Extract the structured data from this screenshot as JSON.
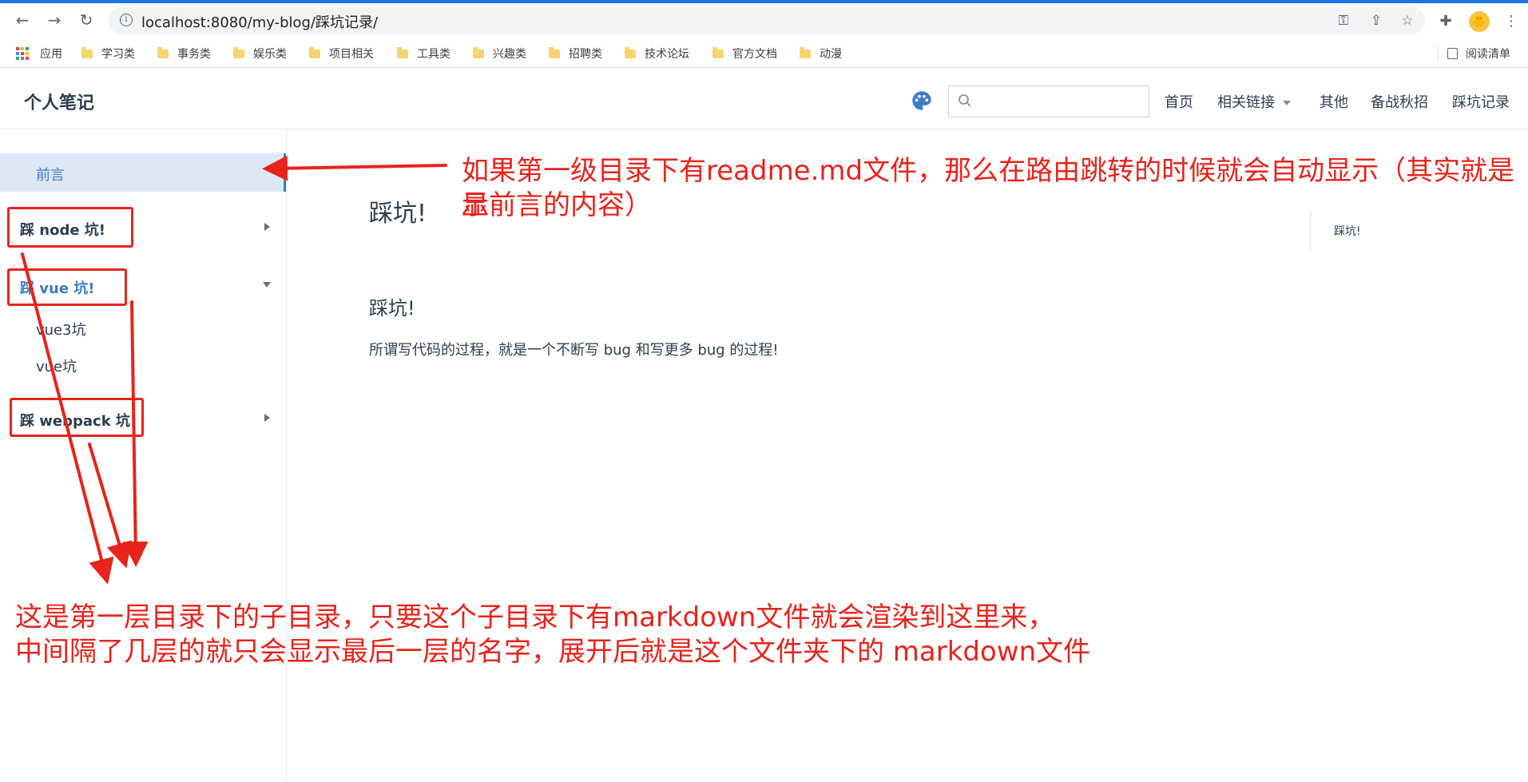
{
  "browser": {
    "url": "localhost:8080/my-blog/踩坑记录/",
    "bookmarks": [
      "应用",
      "学习类",
      "事务类",
      "娱乐类",
      "项目相关",
      "工具类",
      "兴趣类",
      "招聘类",
      "技术论坛",
      "官方文档",
      "动漫"
    ],
    "reading_list": "阅读清单",
    "accent_color": "#1a73e8"
  },
  "site": {
    "title": "个人笔记",
    "search_placeholder": "",
    "nav": [
      "首页",
      "相关链接",
      "其他",
      "备战秋招",
      "踩坑记录"
    ]
  },
  "sidebar": {
    "active_item": "前言",
    "groups": [
      "踩 node 坑!",
      "踩 vue 坑!",
      "踩 webpack 坑!"
    ],
    "vue_children": [
      "vue3坑",
      "vue坑"
    ]
  },
  "content": {
    "page_title": "踩坑!",
    "section_title": "踩坑!",
    "paragraph": "所谓写代码的过程，就是一个不断写 bug 和写更多 bug 的过程!",
    "toc_item": "踩坑!"
  },
  "annotations": {
    "top_line1": "如果第一级目录下有readme.md文件，那么在路由跳转的时候就会自动显示（其实就是显",
    "top_line2": "示前言的内容）",
    "bottom_line1": "这是第一层目录下的子目录，只要这个子目录下有markdown文件就会渲染到这里来，",
    "bottom_line2": "中间隔了几层的就只会显示最后一层的名字，展开后就是这个文件夹下的 markdown文件",
    "color": "#e8231c"
  }
}
